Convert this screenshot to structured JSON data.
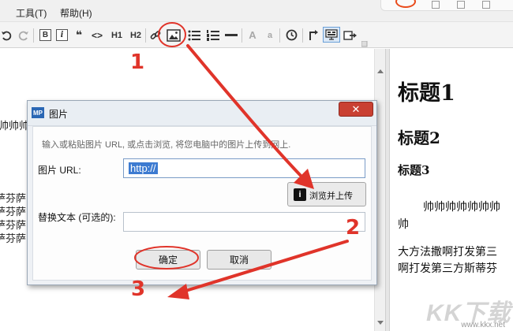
{
  "menubar": {
    "tools": "工具(T)",
    "help": "帮助(H)"
  },
  "toolbar": {
    "bold": "B",
    "italic": "i",
    "quote": "❝",
    "code": "<>",
    "h1": "H1",
    "h2": "H2",
    "font_large": "A",
    "font_small": "a",
    "icons": [
      "undo-icon",
      "redo-icon",
      "link-icon",
      "image-icon",
      "bullet-list-icon",
      "numbered-list-icon",
      "horizontal-rule-icon",
      "clock-icon",
      "insert-icon",
      "preview-icon",
      "export-icon"
    ]
  },
  "editor": {
    "lines": [
      "帅帅帅",
      "萨芬萨",
      "萨芬萨",
      "萨芬萨",
      "萨芬萨"
    ]
  },
  "preview": {
    "h1": "标题1",
    "h2": "标题2",
    "h3": "标题3",
    "p1": "帅帅帅帅帅帅帅",
    "p1_cont": "帅",
    "p2": "大方法撒啊打发第三",
    "p2_cont": "啊打发第三方斯蒂芬"
  },
  "dialog": {
    "icon_label": "MP",
    "title": "图片",
    "close": "✕",
    "hint": "输入或粘贴图片 URL, 或点击浏览, 将您电脑中的图片上传到网上.",
    "url_label": "图片 URL:",
    "url_value": "http://",
    "browse_icon": "i",
    "browse_label": "浏览并上传",
    "alt_label": "替换文本 (可选的):",
    "alt_value": "",
    "ok": "确定",
    "cancel": "取消"
  },
  "annotations": {
    "step1": "1",
    "step2": "2",
    "step3": "3",
    "color": "#e0342a"
  },
  "watermark": {
    "logo": "KK下载",
    "url": "www.kkx.net"
  }
}
